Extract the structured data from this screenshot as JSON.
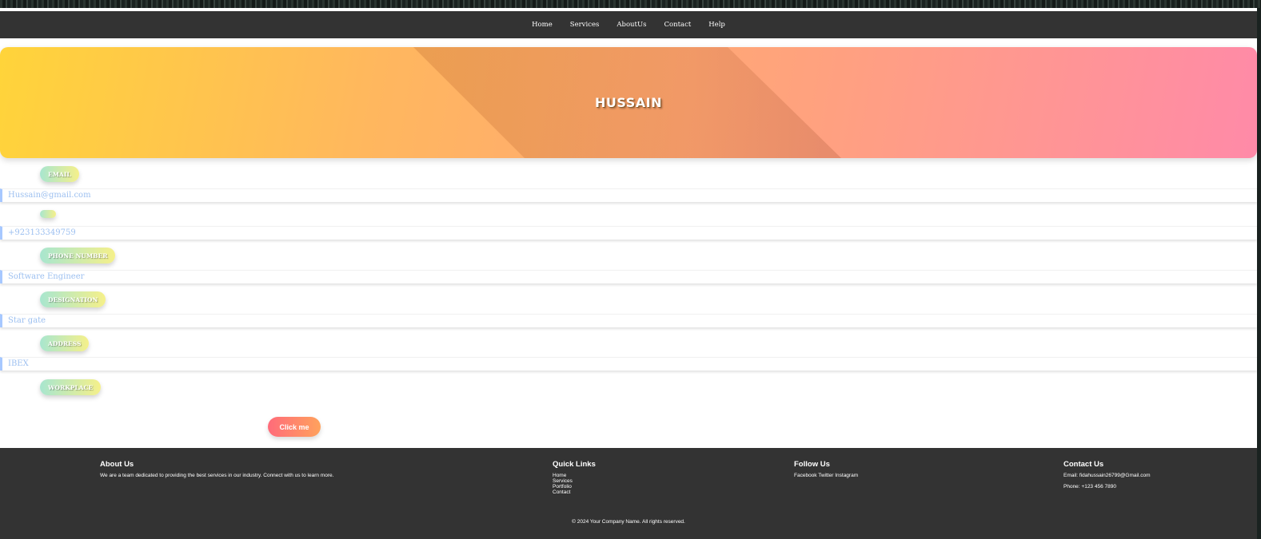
{
  "nav": {
    "items": [
      "Home",
      "Services",
      "AboutUs",
      "Contact",
      "Help"
    ]
  },
  "hero": {
    "title": "HUSSAIN"
  },
  "fields": [
    {
      "label": "EMAIL",
      "value": "Hussain@gmail.com"
    },
    {
      "label": "",
      "value": "+923133349759"
    },
    {
      "label": "PHONE NUMBER",
      "value": "Software Engineer"
    },
    {
      "label": "DESIGNATION",
      "value": "Star gate"
    },
    {
      "label": "ADDRESS",
      "value": "IBEX"
    },
    {
      "label": "WORKPLACE",
      "value": ""
    }
  ],
  "button": {
    "label": "Click me"
  },
  "footer": {
    "about": {
      "title": "About Us",
      "text": "We are a team dedicated to providing the best services in our industry. Connect with us to learn more."
    },
    "quick_links": {
      "title": "Quick Links",
      "items": [
        "Home",
        "Services",
        "Portfolio",
        "Contact"
      ]
    },
    "follow": {
      "title": "Follow Us",
      "items": [
        "Facebook",
        "Twitter",
        "Instagram"
      ]
    },
    "contact": {
      "title": "Contact Us",
      "email": "Email: fidahussain26799@Gmail.com",
      "phone": "Phone: +123 456 7890"
    },
    "copyright": "© 2024 Your Company Name. All rights reserved."
  },
  "colors": {
    "nav_bg": "#333333",
    "hero_start": "#ffd43a",
    "hero_end": "#ff8aa8",
    "badge_start": "#a8e6cf",
    "badge_end": "#f5f08a",
    "field_text": "#9dc0f0",
    "button_start": "#ff6b7a",
    "button_end": "#ffa25d"
  }
}
